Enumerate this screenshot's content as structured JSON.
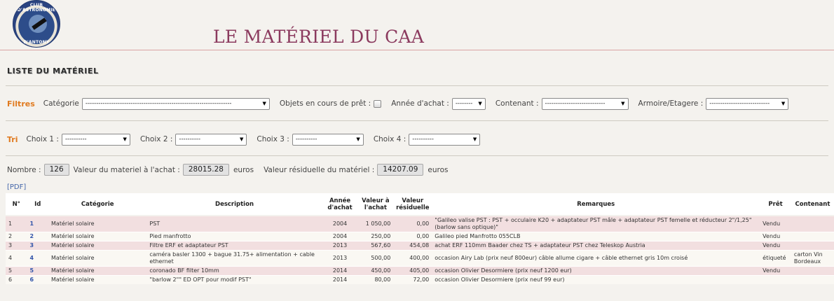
{
  "logo": {
    "top_text": "CLUB D'ASTRONOMIE",
    "bottom_text": "D'ANTONY"
  },
  "page_title": "LE MATÉRIEL DU CAA",
  "section_title": "LISTE DU MATÉRIEL",
  "filters": {
    "label": "Filtres",
    "categorie_label": "Catégorie",
    "categorie_value": "--------------------------------------------------------------------",
    "pret_label": "Objets en cours de prêt :",
    "annee_label": "Année d'achat :",
    "annee_value": "--------",
    "contenant_label": "Contenant :",
    "contenant_value": "----------------------------",
    "armoire_label": "Armoire/Etagere :",
    "armoire_value": "----------------------------"
  },
  "tri": {
    "label": "Tri",
    "choix1_label": "Choix 1 :",
    "choix2_label": "Choix 2 :",
    "choix3_label": "Choix 3 :",
    "choix4_label": "Choix 4 :",
    "choix_value": "----------"
  },
  "stats": {
    "nombre_label": "Nombre :",
    "nombre": "126",
    "valeur_achat_label": "Valeur du materiel à l'achat :",
    "valeur_achat": "28015.28",
    "valeur_res_label": "Valeur résiduelle du matériel :",
    "valeur_res": "14207.09",
    "currency": "euros"
  },
  "pdf_link": "[PDF]",
  "table": {
    "headers": [
      "N°",
      "Id",
      "Catégorie",
      "Description",
      "Année d'achat",
      "Valeur à l'achat",
      "Valeur résiduelle",
      "Remarques",
      "Prêt",
      "Contenant"
    ],
    "rows": [
      [
        "1",
        "1",
        "Matériel solaire",
        "PST",
        "2004",
        "1 050,00",
        "0,00",
        "\"Galileo valise PST : PST + occulaire K20 + adaptateur PST mâle + adaptateur PST femelle et réducteur 2\"/1,25\" (barlow sans optique)\"",
        "Vendu",
        ""
      ],
      [
        "2",
        "2",
        "Matériel solaire",
        "Pied manfrotto",
        "2004",
        "250,00",
        "0,00",
        "Galileo pied Manfrotto 055CLB",
        "Vendu",
        ""
      ],
      [
        "3",
        "3",
        "Matériel solaire",
        "Filtre ERF et adaptateur PST",
        "2013",
        "567,60",
        "454,08",
        "achat ERF 110mm Baader chez TS + adaptateur PST chez Teleskop Austria",
        "Vendu",
        ""
      ],
      [
        "4",
        "4",
        "Matériel solaire",
        "caméra basler 1300 + bague 31.75+ alimentation + cable ethernet",
        "2013",
        "500,00",
        "400,00",
        "occasion Airy Lab (prix neuf 800eur) câble allume cigare + câble ethernet gris 10m croisé",
        "étiqueté",
        "carton Vin Bordeaux"
      ],
      [
        "5",
        "5",
        "Matériel solaire",
        "coronado BF filter 10mm",
        "2014",
        "450,00",
        "405,00",
        "occasion Olivier Desormiere (prix neuf 1200 eur)",
        "Vendu",
        ""
      ],
      [
        "6",
        "6",
        "Matériel solaire",
        "\"barlow 2\"\" ED OPT pour modif PST\"",
        "2014",
        "80,00",
        "72,00",
        "occasion Olivier Desormiere (prix neuf 99 eur)",
        "",
        ""
      ]
    ]
  }
}
